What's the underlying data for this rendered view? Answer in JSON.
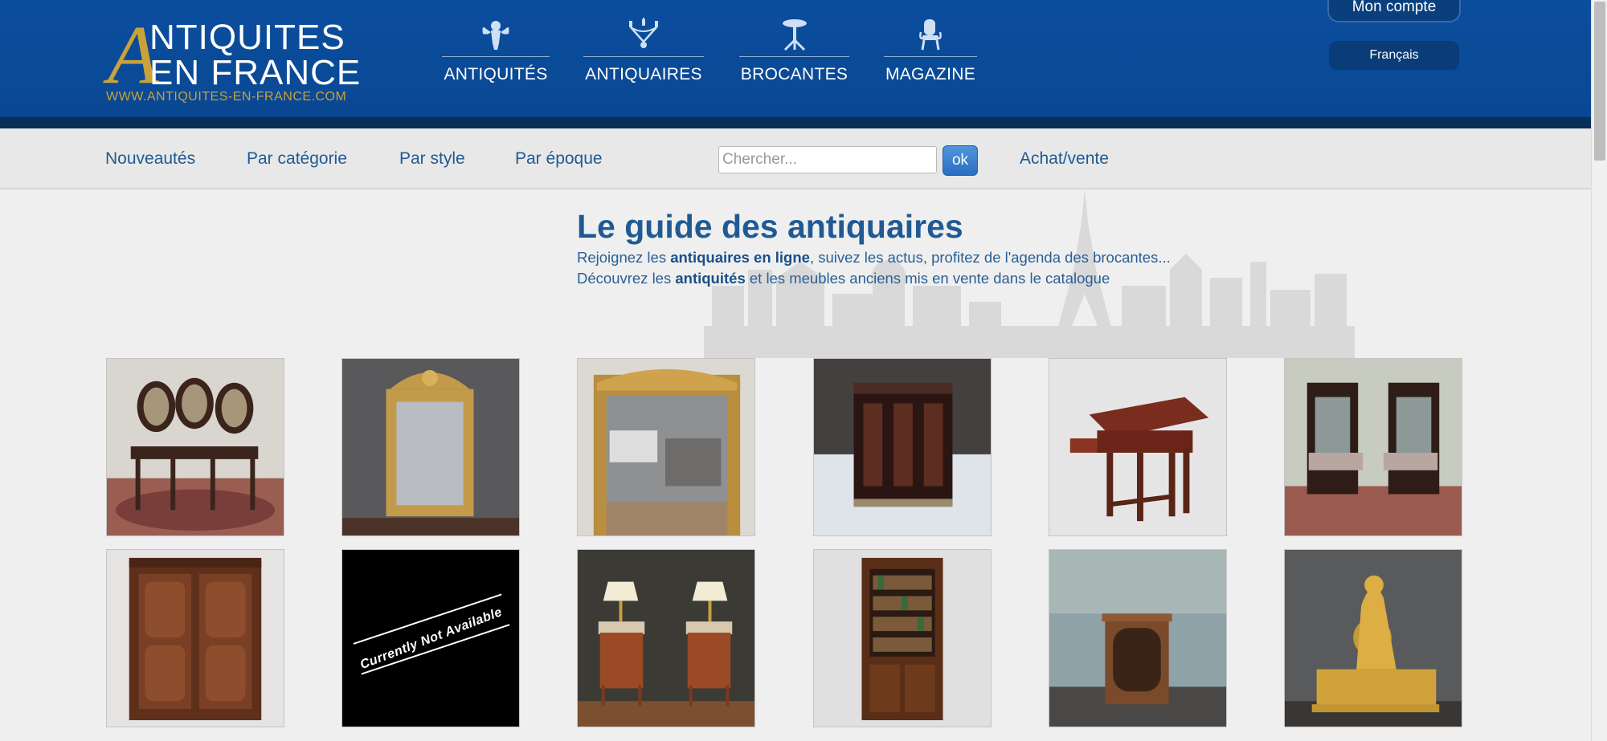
{
  "logo": {
    "big_letter": "A",
    "line1": "NTIQUITES",
    "line2": "EN FRANCE",
    "url": "WWW.ANTIQUITES-EN-FRANCE.COM"
  },
  "main_nav": [
    {
      "label": "ANTIQUITÉS",
      "icon": "cherub-icon"
    },
    {
      "label": "ANTIQUAIRES",
      "icon": "chandelier-icon"
    },
    {
      "label": "BROCANTES",
      "icon": "pedestal-table-icon"
    },
    {
      "label": "MAGAZINE",
      "icon": "armchair-icon"
    }
  ],
  "account": {
    "label": "Mon compte"
  },
  "language": {
    "label": "Français"
  },
  "subnav": [
    {
      "label": "Nouveautés"
    },
    {
      "label": "Par catégorie"
    },
    {
      "label": "Par style"
    },
    {
      "label": "Par époque"
    }
  ],
  "search": {
    "placeholder": "Chercher...",
    "value": "",
    "button": "ok"
  },
  "subnav_right": {
    "label": "Achat/vente"
  },
  "intro": {
    "title": "Le guide des antiquaires",
    "line1_before": "Rejoignez les ",
    "line1_bold": "antiquaires en ligne",
    "line1_after": ", suivez les actus, profitez de l'agenda des brocantes...",
    "line2_before": "Découvrez les ",
    "line2_bold": "antiquités",
    "line2_after": " et les meubles anciens mis en vente dans le catalogue"
  },
  "colors": {
    "header_blue": "#0b4d9e",
    "gold": "#c9a23a",
    "link_blue": "#1f5a94"
  },
  "products": [
    {
      "name": "cane-back-chairs-photo"
    },
    {
      "name": "gilt-frame-mirror-photo"
    },
    {
      "name": "large-gilt-mirror-photo"
    },
    {
      "name": "cabinet-chest-photo"
    },
    {
      "name": "reading-table-photo"
    },
    {
      "name": "pair-of-armchairs-photo"
    },
    {
      "name": "wooden-armoire-photo"
    },
    {
      "name": "not-available-placeholder",
      "text": "Currently Not Available"
    },
    {
      "name": "bedside-tables-lamps-photo"
    },
    {
      "name": "bookcase-cabinet-photo"
    },
    {
      "name": "small-cabinet-photo"
    },
    {
      "name": "gilt-bronze-clock-photo"
    }
  ]
}
